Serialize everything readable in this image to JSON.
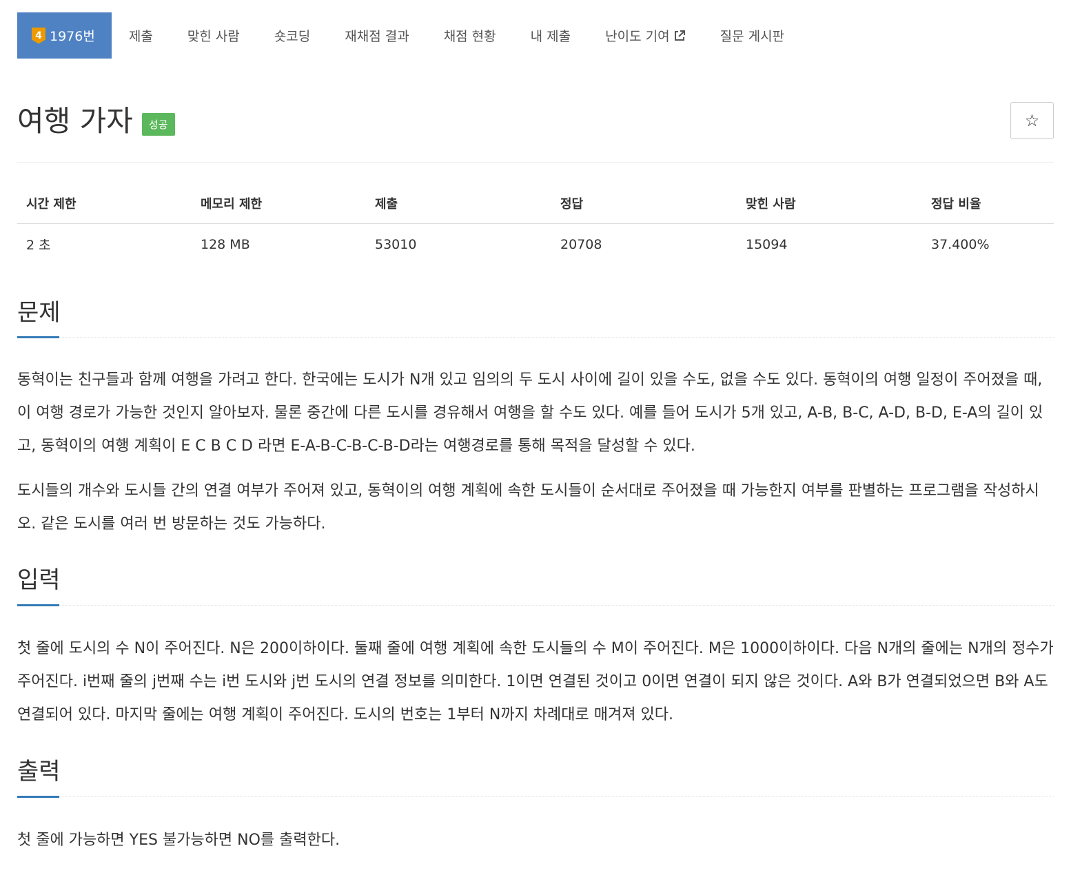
{
  "tabs": {
    "active": {
      "tier": "4",
      "label": "1976번"
    },
    "items": [
      "제출",
      "맞힌 사람",
      "숏코딩",
      "재채점 결과",
      "채점 현황",
      "내 제출",
      "난이도 기여",
      "질문 게시판"
    ]
  },
  "problem": {
    "title": "여행 가자",
    "badge": "성공",
    "star": "☆"
  },
  "stats": {
    "headers": [
      "시간 제한",
      "메모리 제한",
      "제출",
      "정답",
      "맞힌 사람",
      "정답 비율"
    ],
    "values": [
      "2 초",
      "128 MB",
      "53010",
      "20708",
      "15094",
      "37.400%"
    ]
  },
  "sections": {
    "description": {
      "title": "문제",
      "p1": "동혁이는 친구들과 함께 여행을 가려고 한다. 한국에는 도시가 N개 있고 임의의 두 도시 사이에 길이 있을 수도, 없을 수도 있다. 동혁이의 여행 일정이 주어졌을 때, 이 여행 경로가 가능한 것인지 알아보자. 물론 중간에 다른 도시를 경유해서 여행을 할 수도 있다. 예를 들어 도시가 5개 있고, A-B, B-C, A-D, B-D, E-A의 길이 있고, 동혁이의 여행 계획이 E C B C D 라면 E-A-B-C-B-C-B-D라는 여행경로를 통해 목적을 달성할 수 있다.",
      "p2": "도시들의 개수와 도시들 간의 연결 여부가 주어져 있고, 동혁이의 여행 계획에 속한 도시들이 순서대로 주어졌을 때 가능한지 여부를 판별하는 프로그램을 작성하시오. 같은 도시를 여러 번 방문하는 것도 가능하다."
    },
    "input": {
      "title": "입력",
      "p1": "첫 줄에 도시의 수 N이 주어진다. N은 200이하이다. 둘째 줄에 여행 계획에 속한 도시들의 수 M이 주어진다. M은 1000이하이다. 다음 N개의 줄에는 N개의 정수가 주어진다. i번째 줄의 j번째 수는 i번 도시와 j번 도시의 연결 정보를 의미한다. 1이면 연결된 것이고 0이면 연결이 되지 않은 것이다. A와 B가 연결되었으면 B와 A도 연결되어 있다. 마지막 줄에는 여행 계획이 주어진다. 도시의 번호는 1부터 N까지 차례대로 매겨져 있다."
    },
    "output": {
      "title": "출력",
      "p1": "첫 줄에 가능하면 YES 불가능하면 NO를 출력한다."
    }
  }
}
